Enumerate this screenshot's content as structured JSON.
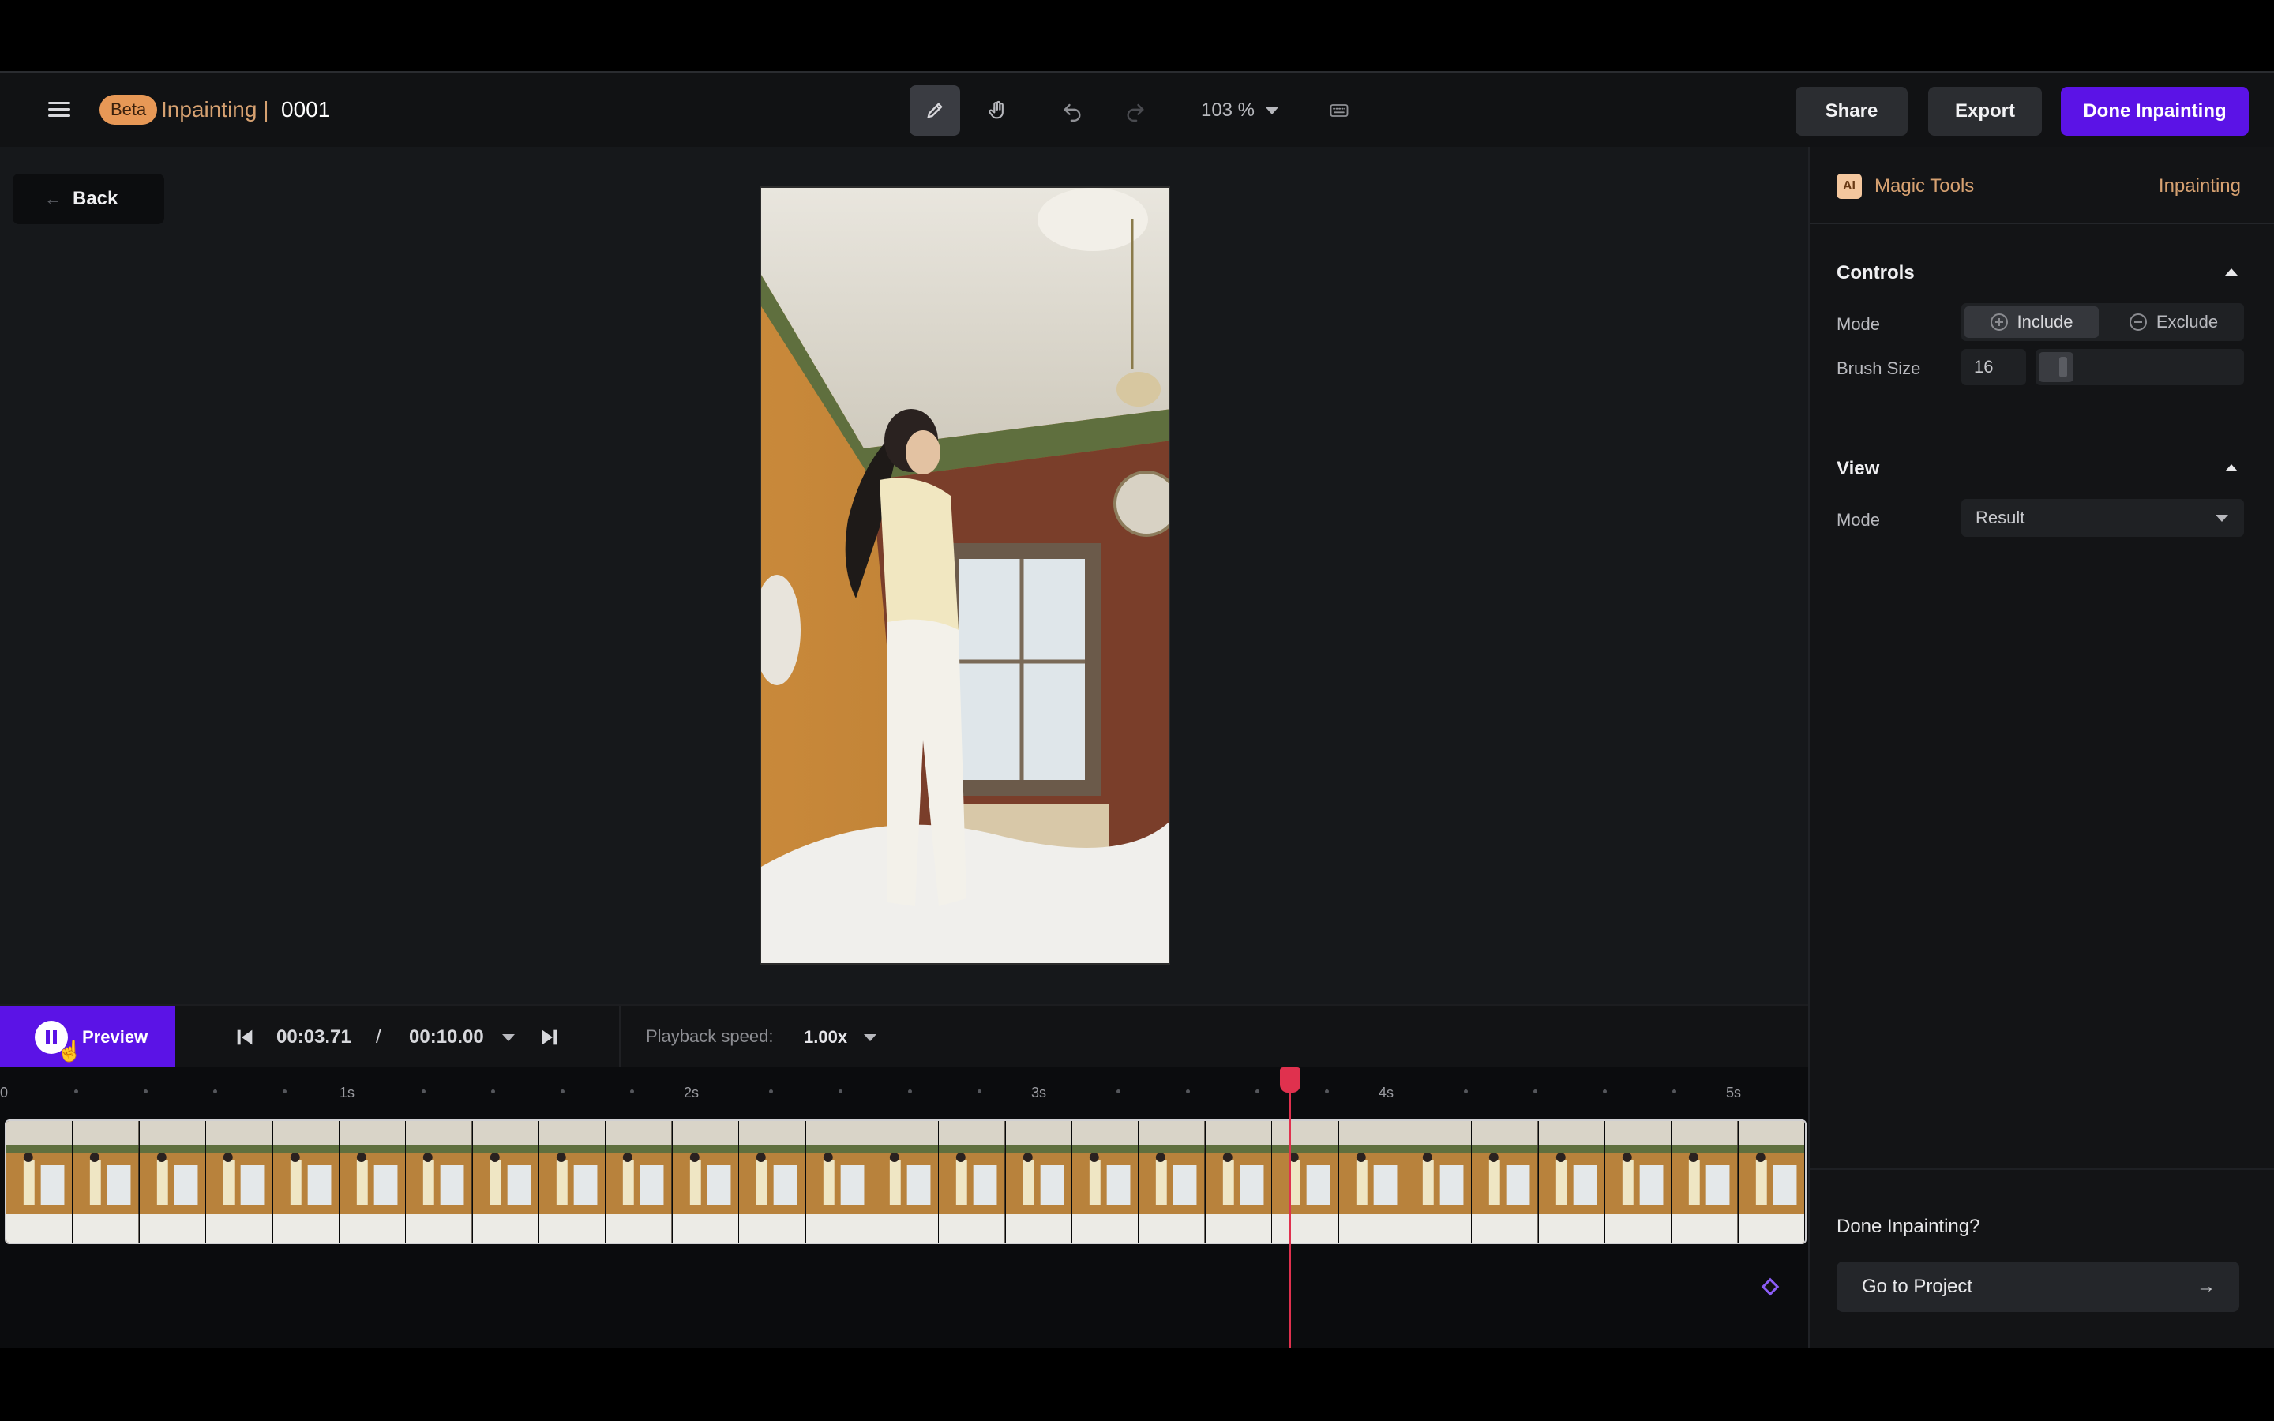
{
  "header": {
    "beta_label": "Beta",
    "title": "Inpainting |",
    "project_id": "0001",
    "zoom": "103 %",
    "share_label": "Share",
    "export_label": "Export",
    "done_label": "Done Inpainting",
    "tools": [
      "brush-icon",
      "hand-icon",
      "undo-icon",
      "redo-icon",
      "keyboard-icon"
    ]
  },
  "canvas": {
    "back_label": "Back"
  },
  "panel": {
    "ai_badge": "AI",
    "magic_tools_label": "Magic Tools",
    "current_tool": "Inpainting",
    "controls": {
      "title": "Controls",
      "mode_label": "Mode",
      "include_label": "Include",
      "exclude_label": "Exclude",
      "brush_label": "Brush Size",
      "brush_value": "16"
    },
    "view": {
      "title": "View",
      "mode_label": "Mode",
      "mode_value": "Result"
    },
    "footer": {
      "question": "Done Inpainting?",
      "go_label": "Go to Project"
    }
  },
  "playback": {
    "preview_label": "Preview",
    "current_time": "00:03.71",
    "separator": "/",
    "total_time": "00:10.00",
    "speed_label": "Playback speed:",
    "speed_value": "1.00x"
  },
  "timeline": {
    "tick_labels": [
      "0",
      "1s",
      "2s",
      "3s",
      "4s",
      "5s"
    ],
    "playhead_time_s": 3.71,
    "visible_span_s": 5.2
  },
  "colors": {
    "accent": "#5b13e6",
    "playhead": "#e0314e",
    "title_tint": "#d6a171",
    "beta_badge": "#e79856",
    "keyframe": "#8b5cf6"
  }
}
